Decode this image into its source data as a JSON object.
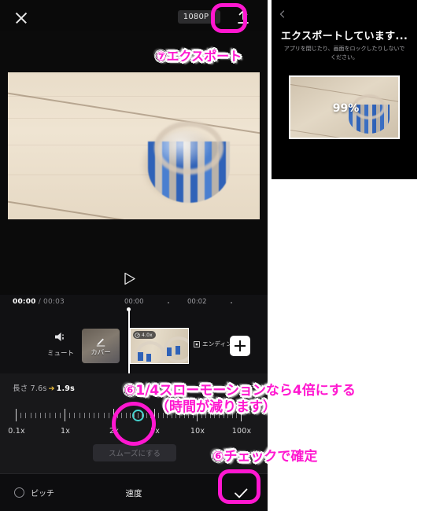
{
  "app": {
    "name": "video-editor",
    "accent_magenta": "#ff17d0",
    "accent_teal": "#45d3cf",
    "accent_yellow": "#f2c33c"
  },
  "topbar": {
    "close_icon": "close-icon",
    "resolution_label": "1080P",
    "resolution_caret": "▾",
    "export_icon": "upload-export-icon"
  },
  "preview": {
    "play_icon": "play-icon"
  },
  "timeline": {
    "current_time": "00:00",
    "separator": " / ",
    "total_time": "00:03",
    "ruler_ticks": [
      "00:00",
      "·",
      "00:02",
      "·"
    ],
    "mute_label": "ミュート",
    "mute_icon": "speaker-mute-icon",
    "cover_label": "カバー",
    "cover_icon": "pencil-icon",
    "clip_speed_badge": "4.0x",
    "clip_speed_icon": "speed-gauge-icon",
    "ending_label": "エンディング",
    "ending_icon": "ending-marker-icon",
    "add_button_icon": "plus-icon"
  },
  "speed_panel": {
    "length_label": "長さ",
    "length_from": "7.6s",
    "length_arrow": "➔",
    "length_to": "1.9s",
    "scale_labels": [
      "0.1x",
      "1x",
      "2x",
      "5x",
      "10x",
      "100x"
    ],
    "selected_value": "4.0x",
    "smooth_button": "スムーズにする"
  },
  "bottombar": {
    "pitch_label": "ピッチ",
    "pitch_toggle_icon": "circle-toggle-icon",
    "title": "速度",
    "confirm_icon": "check-icon"
  },
  "export_panel": {
    "back_icon": "chevron-left-icon",
    "title": "エクスポートしています...",
    "subtitle": "アプリを閉じたり、画面をロックしたりしないでください。",
    "progress_percent": "99%"
  },
  "annotations": [
    {
      "id": "export",
      "text": "⑦エクスポート"
    },
    {
      "id": "slow-line1",
      "text": "⑥1/4スローモーションなら4倍にする"
    },
    {
      "id": "slow-line2",
      "text": "（時間が減ります）"
    },
    {
      "id": "check",
      "text": "⑥チェックで確定"
    }
  ]
}
